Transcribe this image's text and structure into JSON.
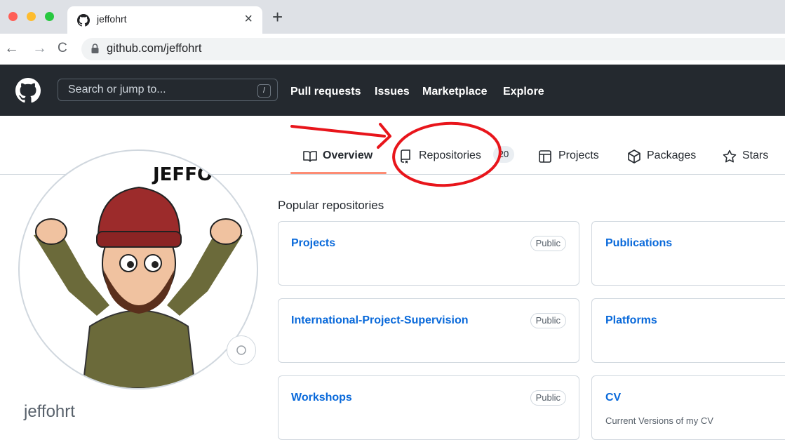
{
  "browser": {
    "tab_title": "jeffohrt",
    "tab_close": "×",
    "new_tab": "+",
    "url_domain": "github.com/",
    "url_path": "jeffohrt",
    "back": "←",
    "forward": "→",
    "reload": "C"
  },
  "header": {
    "search_placeholder": "Search or jump to...",
    "search_shortcut": "/",
    "nav": [
      "Pull requests",
      "Issues",
      "Marketplace",
      "Explore"
    ]
  },
  "profile_tabs": [
    {
      "label": "Overview",
      "icon": "book-icon",
      "active": true
    },
    {
      "label": "Repositories",
      "icon": "repo-icon",
      "counter": "20"
    },
    {
      "label": "Projects",
      "icon": "table-icon"
    },
    {
      "label": "Packages",
      "icon": "package-icon"
    },
    {
      "label": "Stars",
      "icon": "star-icon"
    }
  ],
  "profile": {
    "username": "jeffohrt",
    "avatar_text": "JEFFO"
  },
  "popular": {
    "title": "Popular repositories",
    "repos": [
      {
        "name": "Projects",
        "visibility": "Public",
        "description": ""
      },
      {
        "name": "Publications",
        "visibility": "",
        "description": ""
      },
      {
        "name": "International-Project-Supervision",
        "visibility": "Public",
        "description": ""
      },
      {
        "name": "Platforms",
        "visibility": "",
        "description": ""
      },
      {
        "name": "Workshops",
        "visibility": "Public",
        "description": ""
      },
      {
        "name": "CV",
        "visibility": "",
        "description": "Current Versions of my CV"
      }
    ]
  },
  "colors": {
    "annotation": "#e8151b",
    "link": "#0969da",
    "header_bg": "#24292f",
    "active_underline": "#fd8c73"
  }
}
